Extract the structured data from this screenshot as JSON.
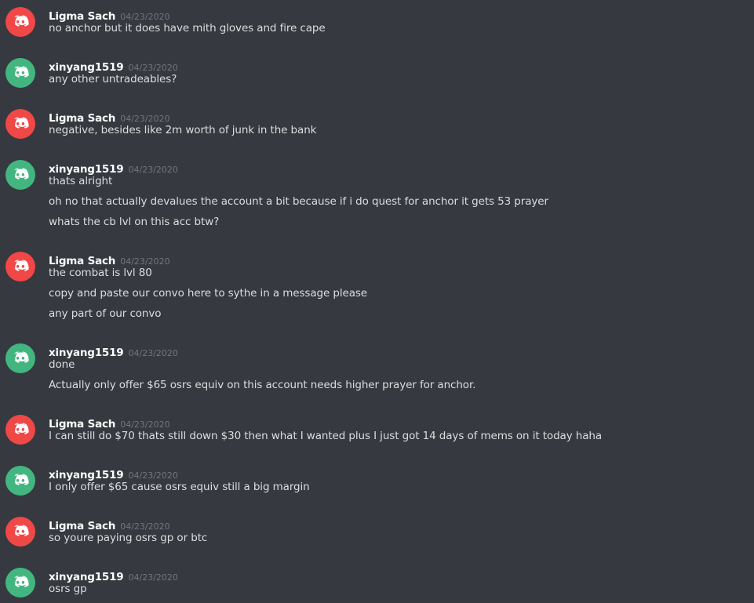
{
  "colors": {
    "background": "#36393f",
    "red_avatar": "#f04747",
    "green_avatar": "#43b581",
    "username": "#ffffff",
    "timestamp": "#72767d",
    "message_text": "#dcddde"
  },
  "avatar_icon": "discord-logo-icon",
  "messages": [
    {
      "author": "Ligma Sach",
      "timestamp": "04/23/2020",
      "avatar_color": "red",
      "lines": [
        "no anchor but it does have mith gloves and fire cape"
      ]
    },
    {
      "author": "xinyang1519",
      "timestamp": "04/23/2020",
      "avatar_color": "green",
      "lines": [
        "any other untradeables?"
      ]
    },
    {
      "author": "Ligma Sach",
      "timestamp": "04/23/2020",
      "avatar_color": "red",
      "lines": [
        "negative, besides like 2m worth of junk in the bank"
      ]
    },
    {
      "author": "xinyang1519",
      "timestamp": "04/23/2020",
      "avatar_color": "green",
      "lines": [
        "thats alright",
        "oh no that actually devalues the account a bit because if i do quest for anchor it gets 53 prayer",
        "whats the cb lvl on this acc btw?"
      ]
    },
    {
      "author": "Ligma Sach",
      "timestamp": "04/23/2020",
      "avatar_color": "red",
      "lines": [
        "the combat is lvl 80",
        "copy and paste our convo here to sythe in a message please",
        "any part of our convo"
      ]
    },
    {
      "author": "xinyang1519",
      "timestamp": "04/23/2020",
      "avatar_color": "green",
      "lines": [
        "done",
        "Actually only offer $65 osrs equiv on this account needs higher prayer for anchor."
      ]
    },
    {
      "author": "Ligma Sach",
      "timestamp": "04/23/2020",
      "avatar_color": "red",
      "lines": [
        "I can still do $70 thats still down $30 then what I wanted plus I just got 14 days of mems on it today haha"
      ]
    },
    {
      "author": "xinyang1519",
      "timestamp": "04/23/2020",
      "avatar_color": "green",
      "lines": [
        "I only offer $65 cause osrs equiv still a big margin"
      ]
    },
    {
      "author": "Ligma Sach",
      "timestamp": "04/23/2020",
      "avatar_color": "red",
      "lines": [
        "so youre paying osrs gp or btc"
      ]
    },
    {
      "author": "xinyang1519",
      "timestamp": "04/23/2020",
      "avatar_color": "green",
      "lines": [
        "osrs gp"
      ]
    }
  ]
}
